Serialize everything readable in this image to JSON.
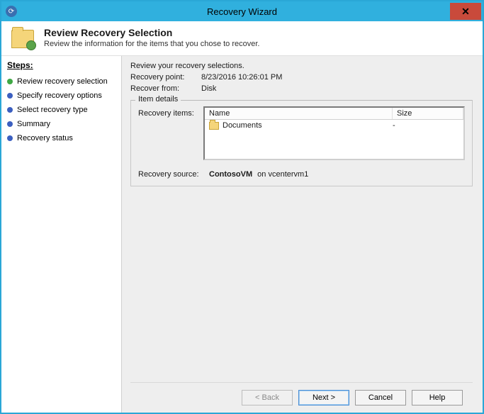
{
  "window": {
    "title": "Recovery Wizard"
  },
  "header": {
    "title": "Review Recovery Selection",
    "subtitle": "Review the information for the items that you chose to recover."
  },
  "sidebar": {
    "steps_label": "Steps:",
    "steps": [
      {
        "label": "Review recovery selection",
        "current": true
      },
      {
        "label": "Specify recovery options",
        "current": false
      },
      {
        "label": "Select recovery type",
        "current": false
      },
      {
        "label": "Summary",
        "current": false
      },
      {
        "label": "Recovery status",
        "current": false
      }
    ]
  },
  "main": {
    "intro": "Review your recovery selections.",
    "recovery_point_label": "Recovery point:",
    "recovery_point_value": "8/23/2016 10:26:01 PM",
    "recover_from_label": "Recover from:",
    "recover_from_value": "Disk",
    "item_details_label": "Item details",
    "recovery_items_label": "Recovery items:",
    "columns": {
      "name": "Name",
      "size": "Size"
    },
    "items": [
      {
        "name": "Documents",
        "size": "-"
      }
    ],
    "recovery_source_label": "Recovery source:",
    "recovery_source_strong": "ContosoVM",
    "recovery_source_tail": "on vcentervm1"
  },
  "footer": {
    "back": "< Back",
    "next": "Next >",
    "cancel": "Cancel",
    "help": "Help"
  }
}
